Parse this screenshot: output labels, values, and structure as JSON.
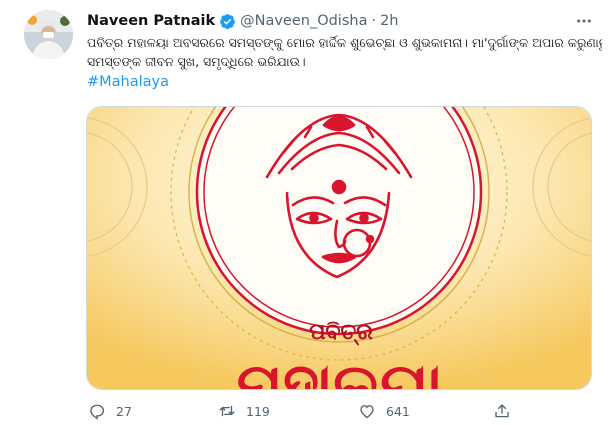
{
  "tweet": {
    "author_name": "Naveen Patnaik",
    "handle": "@Naveen_Odisha",
    "separator": "·",
    "time": "2h",
    "text_line1": "ପବିତ୍ର ମହାଳୟା ଅବସରରେ ସମସ୍ତଙ୍କୁ ମୋର ହାର୍ଦ୍ଦିକ ଶୁଭେଚ୍ଛା ଓ ଶୁଭକାମନା। ମା'ଦୁର୍ଗାଙ୍କ ଅପାର କରୁଣାରୁ",
    "text_line2": "ସମସ୍ତଙ୍କ ଜୀବନ ସୁଖ, ସମୃଦ୍ଧିରେ ଭରିଯାଉ।",
    "hashtag": "#Mahalaya",
    "media": {
      "line1": "ପବିତ୍ର",
      "line2": "ମହାଳୟା",
      "accent_color": "#d9152e",
      "gold_color": "#c59a1f"
    },
    "actions": {
      "reply_count": "27",
      "retweet_count": "119",
      "like_count": "641"
    },
    "icons": [
      "verified-badge-icon",
      "more-options-icon",
      "reply-icon",
      "retweet-icon",
      "like-icon",
      "share-icon"
    ],
    "colors": {
      "link": "#1d9bf0",
      "secondary_text": "#536471",
      "verified": "#1d9bf0"
    }
  }
}
